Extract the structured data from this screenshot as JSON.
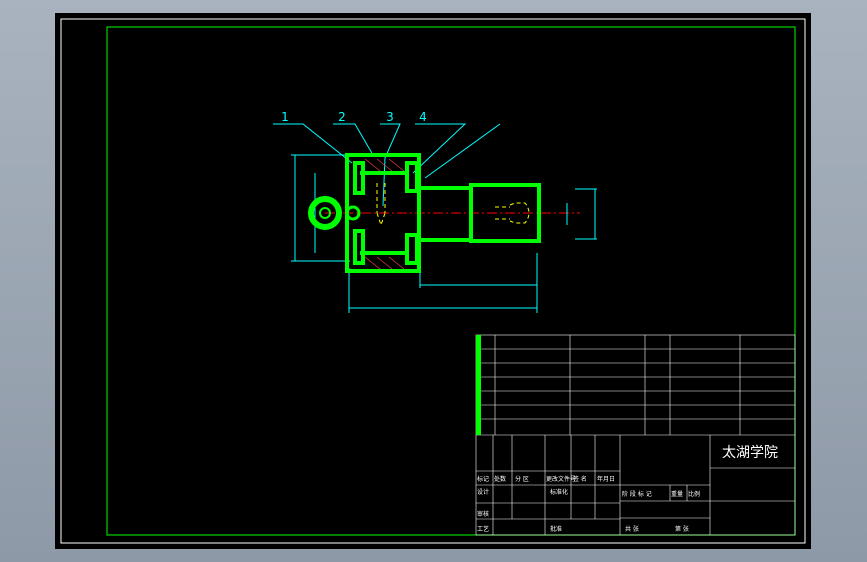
{
  "drawing": {
    "leaders": [
      "1",
      "2",
      "3",
      "4"
    ]
  },
  "title_block": {
    "school": "太湖学院",
    "row_marks": [
      "标记",
      "处数",
      "分 区",
      "更改文件号",
      "签 名",
      "年月日"
    ],
    "designer": "设计",
    "standardization": "标准化",
    "stage_marks": [
      "阶 段 标 记",
      "重量",
      "比例"
    ],
    "review": "审核",
    "process": "工艺",
    "approve": "批准",
    "sheets_total": "共 张",
    "sheet_no": "第 张"
  },
  "colors": {
    "sheet_bg": "#000000",
    "frame": "#ffffff",
    "part": "#00ff00",
    "thin": "#00ffff",
    "center": "#ff0000",
    "hidden": "#ffff00"
  }
}
